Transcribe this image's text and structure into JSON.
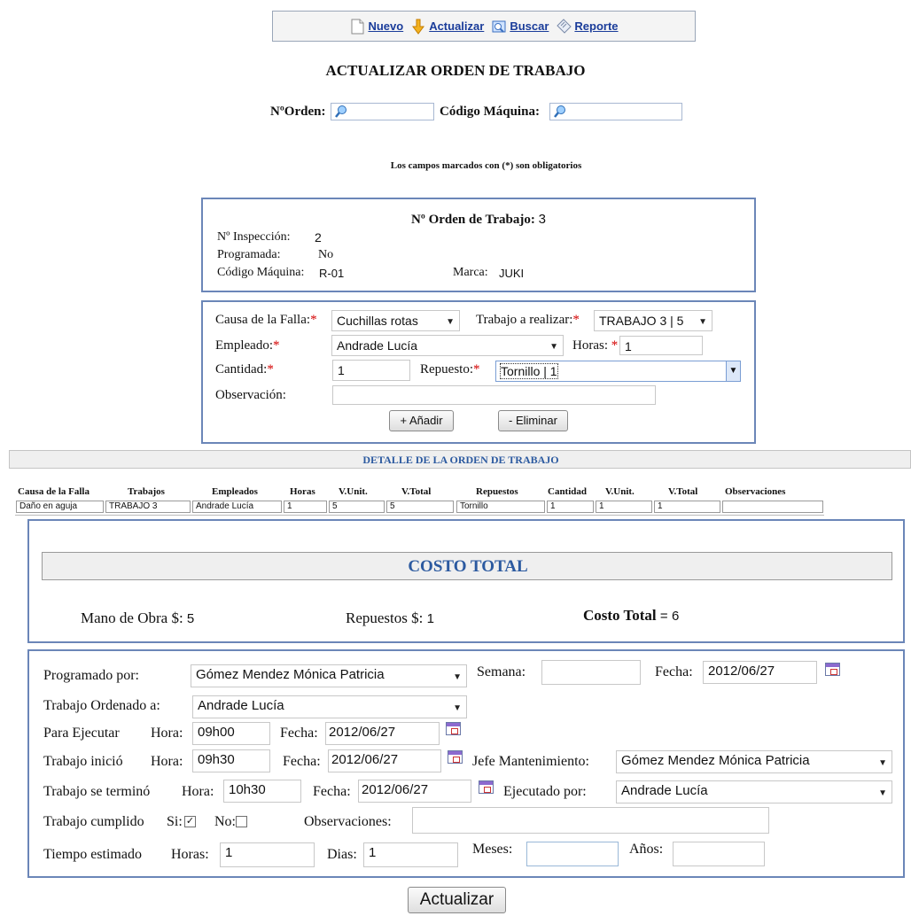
{
  "toolbar": {
    "items": [
      {
        "label": "Nuevo",
        "icon": "new-document-icon"
      },
      {
        "label": "Actualizar",
        "icon": "update-arrow-icon"
      },
      {
        "label": "Buscar",
        "icon": "search-icon"
      },
      {
        "label": "Reporte",
        "icon": "report-icon"
      }
    ]
  },
  "page_title": "ACTUALIZAR ORDEN DE TRABAJO",
  "search": {
    "orden_label": "NºOrden:",
    "codigo_label": "Código Máquina:"
  },
  "required_note": "Los campos marcados con (*) son obligatorios",
  "summary": {
    "orden_label": "Nº Orden de Trabajo:",
    "orden_value": "3",
    "inspeccion_label": "Nº Inspección:",
    "inspeccion_value": "2",
    "programada_label": "Programada:",
    "programada_value": "No",
    "codigo_label": "Código Máquina:",
    "codigo_value": "R-01",
    "marca_label": "Marca:",
    "marca_value": "JUKI"
  },
  "form": {
    "causa_label": "Causa de la Falla:",
    "causa_value": "Cuchillas rotas",
    "trabajo_label": "Trabajo a realizar:",
    "trabajo_value": "TRABAJO 3 | 5",
    "empleado_label": "Empleado:",
    "empleado_value": "Andrade Lucía",
    "horas_label": "Horas:",
    "horas_value": "1",
    "cantidad_label": "Cantidad:",
    "cantidad_value": "1",
    "repuesto_label": "Repuesto:",
    "repuesto_value": "Tornillo | 1",
    "observacion_label": "Observación:",
    "observacion_value": "",
    "add_label": "+ Añadir",
    "remove_label": "- Eliminar",
    "asterisk": "*"
  },
  "detail": {
    "title": "DETALLE DE LA ORDEN DE TRABAJO",
    "headers": [
      "Causa de la Falla",
      "Trabajos",
      "Empleados",
      "Horas",
      "V.Unit.",
      "V.Total",
      "Repuestos",
      "Cantidad",
      "V.Unit.",
      "V.Total",
      "Observaciones"
    ],
    "row": [
      "Daño en aguja",
      "TRABAJO 3",
      "Andrade Lucía",
      "1",
      "5",
      "5",
      "Tornillo",
      "1",
      "1",
      "1",
      ""
    ]
  },
  "costs": {
    "title": "COSTO TOTAL",
    "mano_label": "Mano de Obra $:",
    "mano_value": "5",
    "repuestos_label": "Repuestos $:",
    "repuestos_value": "1",
    "total_label": "Costo Total",
    "total_eq": "=",
    "total_value": "6"
  },
  "schedule": {
    "programado_label": "Programado por:",
    "programado_value": "Gómez Mendez Mónica Patricia",
    "semana_label": "Semana:",
    "semana_value": "",
    "fecha_label": "Fecha:",
    "fecha_value": "2012/06/27",
    "ordenado_label": "Trabajo Ordenado a:",
    "ordenado_value": "Andrade Lucía",
    "ejecutar_label": "Para Ejecutar",
    "hora_label": "Hora:",
    "ejecutar_hora": "09h00",
    "ejecutar_fecha": "2012/06/27",
    "inicio_label": "Trabajo inició",
    "inicio_hora": "09h30",
    "inicio_fecha": "2012/06/27",
    "jefe_label": "Jefe Mantenimiento:",
    "jefe_value": "Gómez Mendez Mónica Patricia",
    "termino_label": "Trabajo se terminó",
    "termino_hora": "10h30",
    "termino_fecha": "2012/06/27",
    "ejecutado_label": "Ejecutado por:",
    "ejecutado_value": "Andrade Lucía",
    "cumplido_label": "Trabajo cumplido",
    "si_label": "Si:",
    "no_label": "No:",
    "observaciones_label": "Observaciones:",
    "observaciones_value": "",
    "estimado_label": "Tiempo estimado",
    "horas_label": "Horas:",
    "horas_value": "1",
    "dias_label": "Dias:",
    "dias_value": "1",
    "meses_label": "Meses:",
    "meses_value": "",
    "anos_label": "Años:",
    "anos_value": ""
  },
  "submit_label": "Actualizar"
}
